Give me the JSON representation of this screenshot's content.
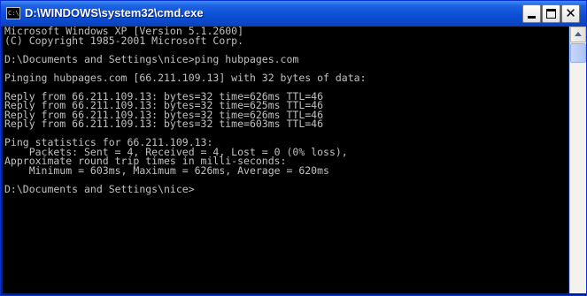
{
  "window": {
    "title": "D:\\WINDOWS\\system32\\cmd.exe",
    "icon_label": "C:\\",
    "controls": {
      "minimize": "minimize",
      "maximize": "maximize",
      "close": "✕"
    }
  },
  "console": {
    "lines": [
      "Microsoft Windows XP [Version 5.1.2600]",
      "(C) Copyright 1985-2001 Microsoft Corp.",
      "",
      "D:\\Documents and Settings\\nice>ping hubpages.com",
      "",
      "Pinging hubpages.com [66.211.109.13] with 32 bytes of data:",
      "",
      "Reply from 66.211.109.13: bytes=32 time=626ms TTL=46",
      "Reply from 66.211.109.13: bytes=32 time=625ms TTL=46",
      "Reply from 66.211.109.13: bytes=32 time=626ms TTL=46",
      "Reply from 66.211.109.13: bytes=32 time=603ms TTL=46",
      "",
      "Ping statistics for 66.211.109.13:",
      "    Packets: Sent = 4, Received = 4, Lost = 0 (0% loss),",
      "Approximate round trip times in milli-seconds:",
      "    Minimum = 603ms, Maximum = 626ms, Average = 620ms",
      "",
      "D:\\Documents and Settings\\nice>"
    ]
  },
  "colors": {
    "titlebar": "#0a4fd6",
    "console_bg": "#000000",
    "console_text": "#c0c0c0"
  }
}
